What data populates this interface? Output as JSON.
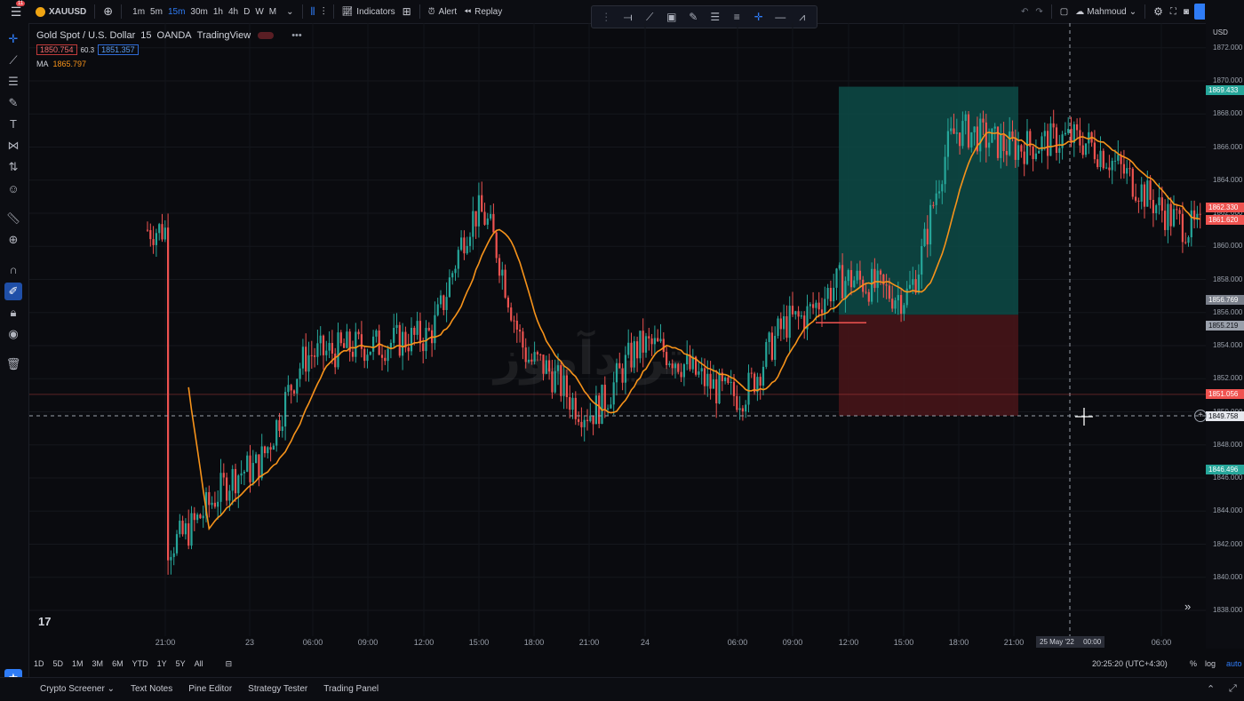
{
  "topbar": {
    "notification_count": "11",
    "symbol": "XAUUSD",
    "timeframes": [
      "1m",
      "5m",
      "15m",
      "30m",
      "1h",
      "4h",
      "D",
      "W",
      "M"
    ],
    "active_timeframe": "15m",
    "indicators_label": "Indicators",
    "alert_label": "Alert",
    "replay_label": "Replay",
    "user_name": "Mahmoud"
  },
  "legend": {
    "title": "Gold Spot / U.S. Dollar",
    "interval": "15",
    "exchange": "OANDA",
    "provider": "TradingView",
    "bid": "1850.754",
    "spread": "60.3",
    "ask": "1851.357",
    "ma_label": "MA",
    "ma_value": "1865.797"
  },
  "price_axis": {
    "currency": "USD",
    "ticks": [
      "1872.000",
      "1870.000",
      "1868.000",
      "1866.000",
      "1864.000",
      "1862.000",
      "1860.000",
      "1858.000",
      "1856.000",
      "1854.000",
      "1852.000",
      "1850.000",
      "1848.000",
      "1846.000",
      "1844.000",
      "1842.000",
      "1840.000",
      "1838.000"
    ]
  },
  "price_labels": {
    "target": "1869.433",
    "current_a": "1862.330",
    "current_b": "1861.620",
    "entry_top": "1856.769",
    "entry": "1855.219",
    "bid_line": "1851.056",
    "crosshair": "1849.758",
    "stop": "1846.496"
  },
  "time_axis": {
    "labels": [
      "21:00",
      "23",
      "06:00",
      "09:00",
      "12:00",
      "15:00",
      "18:00",
      "21:00",
      "24",
      "06:00",
      "09:00",
      "12:00",
      "15:00",
      "18:00",
      "21:00",
      "06:00"
    ],
    "highlight": "25 May '22",
    "highlight_time": "00:00"
  },
  "range_bar": {
    "ranges": [
      "1D",
      "5D",
      "1M",
      "3M",
      "6M",
      "YTD",
      "1Y",
      "5Y",
      "All"
    ],
    "clock": "20:25:20 (UTC+4:30)",
    "percent": "%",
    "log": "log",
    "auto": "auto"
  },
  "bottom_tabs": [
    "Crypto Screener",
    "Text Notes",
    "Pine Editor",
    "Strategy Tester",
    "Trading Panel"
  ],
  "watermark": "تریدآموز",
  "colors": {
    "bull": "#26a69a",
    "bear": "#ef5350",
    "ma": "#f7931a",
    "accent": "#2f7cf6",
    "profit_zone": "#0d4b47",
    "loss_zone": "#4a1519"
  },
  "chart_data": {
    "type": "candlestick",
    "symbol": "XAUUSD",
    "interval": "15",
    "ylim": [
      1837,
      1873
    ],
    "indicator": "MA",
    "position": {
      "type": "long",
      "entry": 1855.219,
      "target": 1869.433,
      "stop": 1849.758
    },
    "close_path": [
      [
        "21:00",
        1842.0
      ],
      [
        "23",
        1846.5
      ],
      [
        "06:00",
        1853.5
      ],
      [
        "09:00",
        1854.0
      ],
      [
        "12:00",
        1854.5
      ],
      [
        "15:00",
        1862.0
      ],
      [
        "18:00",
        1853.0
      ],
      [
        "21:00",
        1850.0
      ],
      [
        "24",
        1854.0
      ],
      [
        "06:00",
        1851.0
      ],
      [
        "09:00",
        1855.5
      ],
      [
        "12:00",
        1858.0
      ],
      [
        "15:00",
        1857.0
      ],
      [
        "18:00",
        1867.0
      ],
      [
        "21:00",
        1866.0
      ],
      [
        "00:00",
        1866.5
      ],
      [
        "06:00",
        1861.0
      ]
    ]
  }
}
